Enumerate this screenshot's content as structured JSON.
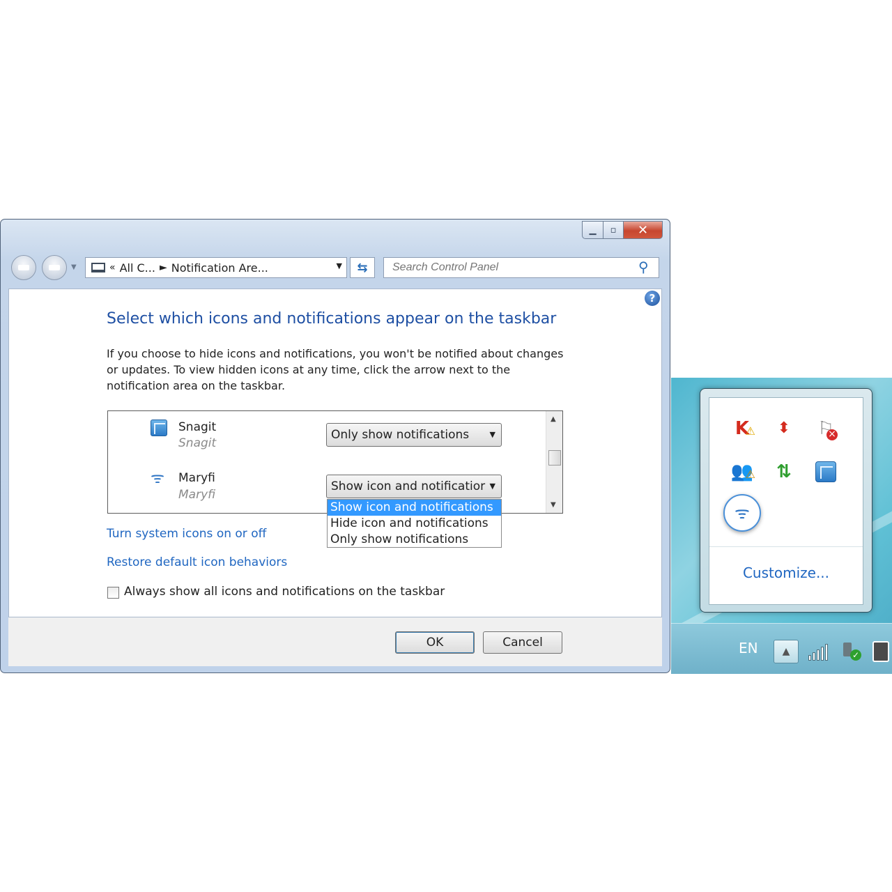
{
  "window": {
    "captions": {
      "minimize": "▁",
      "maximize": "▫",
      "close": "✕"
    },
    "address": {
      "chevron": "«",
      "crumb1": "All C...",
      "separator": "►",
      "crumb2": "Notification Are...",
      "dropdown": "▼"
    },
    "refresh": "⇆",
    "search": {
      "placeholder": "Search Control Panel",
      "value": ""
    },
    "help": "?",
    "title": "Select which icons and notifications appear on the taskbar",
    "description": "If you choose to hide icons and notifications, you won't be notified about changes or updates. To view hidden icons at any time, click the arrow next to the notification area on the taskbar.",
    "rows": [
      {
        "name": "Snagit",
        "subtitle": "Snagit",
        "behavior": "Only show notifications"
      },
      {
        "name": "Maryfi",
        "subtitle": "Maryfi",
        "behavior": "Show icon and notificatior"
      }
    ],
    "dropdown_options": [
      "Show icon and notifications",
      "Hide icon and notifications",
      "Only show notifications"
    ],
    "links": {
      "system_icons": "Turn system icons on or off",
      "restore": "Restore default icon behaviors"
    },
    "checkbox_label": "Always show all icons and notifications on the taskbar",
    "buttons": {
      "ok": "OK",
      "cancel": "Cancel"
    }
  },
  "tray": {
    "customize": "Customize...",
    "icons": {
      "updown": "⬍",
      "flag": "⚐",
      "users": "👥",
      "sync": "⇅",
      "wifi": "ᯤ"
    }
  },
  "taskbar": {
    "language": "EN",
    "show_hidden": "▲"
  }
}
